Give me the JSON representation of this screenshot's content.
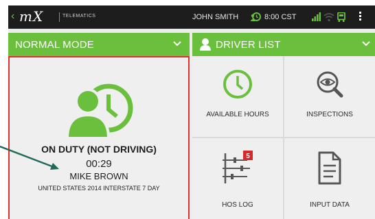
{
  "status_bar": {
    "back_glyph": "‹",
    "brand": "mX",
    "brand_subtitle": "TELEMATICS",
    "user_name": "JOHN SMITH",
    "time": "8:00 CST"
  },
  "mode_bar": {
    "label": "NORMAL MODE"
  },
  "driver_bar": {
    "label": "DRIVER LIST"
  },
  "status_panel": {
    "status": "ON DUTY (NOT DRIVING)",
    "duration": "00:29",
    "driver_name": "MIKE BROWN",
    "ruleset": "UNITED STATES 2014 INTERSTATE 7 DAY"
  },
  "tiles": [
    {
      "label": "AVAILABLE HOURS",
      "icon": "clock-icon"
    },
    {
      "label": "INSPECTIONS",
      "icon": "magnifier-eye-icon"
    },
    {
      "label": "HOS LOG",
      "icon": "log-sliders-icon",
      "badge": "5"
    },
    {
      "label": "INPUT DATA",
      "icon": "document-icon"
    }
  ],
  "colors": {
    "accent_green": "#6abf3c",
    "status_bar": "#1d1d1d",
    "highlight_border": "#e03131",
    "badge_red": "#d62828",
    "annotation_arrow": "#1f6b5a"
  }
}
